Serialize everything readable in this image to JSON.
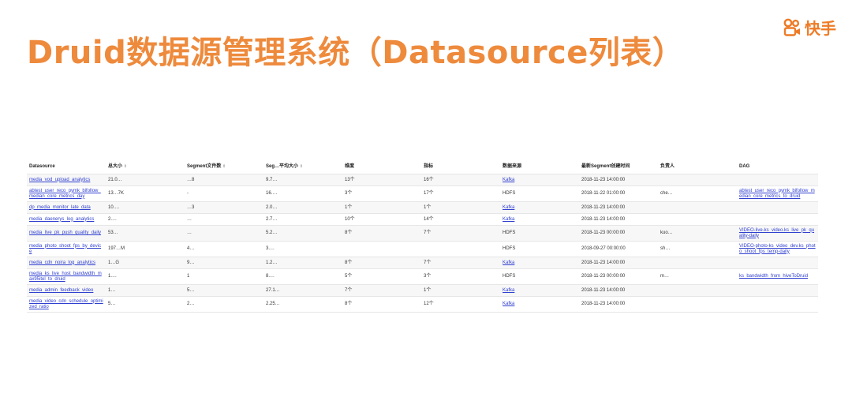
{
  "title": "Druid数据源管理系统（Datasource列表）",
  "logo_text": "快手",
  "brand_color": "#ee8a3c",
  "link_color": "#2f3fcf",
  "columns": [
    {
      "label": "Datasource",
      "sort": ""
    },
    {
      "label": "总大小",
      "sort": "⇕"
    },
    {
      "label": "Segment文件数",
      "sort": "⇕"
    },
    {
      "label": "Seg…平均大小",
      "sort": "⇕"
    },
    {
      "label": "维度",
      "sort": ""
    },
    {
      "label": "指标",
      "sort": ""
    },
    {
      "label": "数据来源",
      "sort": ""
    },
    {
      "label": "最新Segment创建时间",
      "sort": ""
    },
    {
      "label": "负责人",
      "sort": ""
    },
    {
      "label": "DAG",
      "sort": ""
    }
  ],
  "rows": [
    {
      "name": "media_vod_upload_analytics",
      "size": "21.0…",
      "segs": "…8",
      "avg": "9.7…",
      "dims": "13个",
      "mets": "16个",
      "src": "Kafka",
      "time": "2018-11-23 14:00:00",
      "owner": "",
      "dag": ""
    },
    {
      "name": "abtest_user_reco_pymk_bifollow_median_core_metrics_day",
      "size": "13…7K",
      "segs": "-",
      "avg": "16.…",
      "dims": "3个",
      "mets": "17个",
      "src": "HDFS",
      "time": "2018-11-22 01:00:00",
      "owner": "che…",
      "dag": "abtest_user_reco_pymk_bifollow_median_core_metrics_to_druid"
    },
    {
      "name": "dp_media_monitor_late_data",
      "size": "10.…",
      "segs": "…3",
      "avg": "2.0…",
      "dims": "1个",
      "mets": "1个",
      "src": "Kafka",
      "time": "2018-11-23 14:00:00",
      "owner": "",
      "dag": ""
    },
    {
      "name": "media_daenerys_log_analytics",
      "size": "2.…",
      "segs": "…",
      "avg": "2.7…",
      "dims": "10个",
      "mets": "14个",
      "src": "Kafka",
      "time": "2018-11-23 14:00:00",
      "owner": "",
      "dag": ""
    },
    {
      "name": "media_live_pk_push_quality_daily",
      "size": "53…",
      "segs": "…",
      "avg": "5.2…",
      "dims": "8个",
      "mets": "7个",
      "src": "HDFS",
      "time": "2018-11-23 00:00:00",
      "owner": "kuo…",
      "dag": "VIDEO-live-ks_video.ks_live_pk_quality-daily"
    },
    {
      "name": "media_photo_shoot_fps_by_device",
      "size": "197…M",
      "segs": "4…",
      "avg": "3.…",
      "dims": "",
      "mets": "",
      "src": "HDFS",
      "time": "2018-09-27 00:00:00",
      "owner": "sh…",
      "dag": "VIDEO-photo-ks_video_dev.ks_photo_shoot_fps_temp-daily"
    },
    {
      "name": "media_cdn_noira_log_analytics",
      "size": "1…G",
      "segs": "9…",
      "avg": "1.2…",
      "dims": "8个",
      "mets": "7个",
      "src": "Kafka",
      "time": "2018-11-23 14:00:00",
      "owner": "",
      "dag": ""
    },
    {
      "name": "media_ks_live_host_bandwidth_max95itel_to_druid",
      "size": "1.…",
      "segs": "1",
      "avg": "8.…",
      "dims": "5个",
      "mets": "3个",
      "src": "HDFS",
      "time": "2018-11-23 00:00:00",
      "owner": "m…",
      "dag": "ks_bandwidth_from_hiveToDruid"
    },
    {
      "name": "media_admin_feedback_video",
      "size": "1…",
      "segs": "5…",
      "avg": "27.1…",
      "dims": "7个",
      "mets": "1个",
      "src": "Kafka",
      "time": "2018-11-23 14:00:00",
      "owner": "",
      "dag": ""
    },
    {
      "name": "media_video_cdn_schedule_optimized_ratio",
      "size": "5…",
      "segs": "2…",
      "avg": "2.25…",
      "dims": "8个",
      "mets": "12个",
      "src": "Kafka",
      "time": "2018-11-23 14:00:00",
      "owner": "",
      "dag": ""
    }
  ]
}
